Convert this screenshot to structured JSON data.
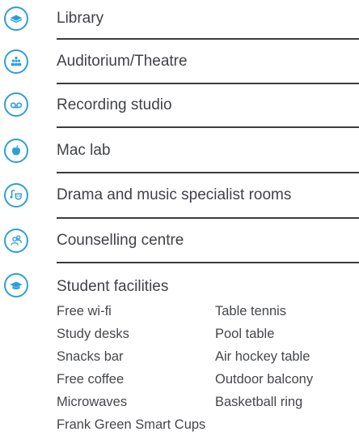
{
  "colors": {
    "accent": "#2f9fd8",
    "rule": "#3b3d40",
    "text": "#404247"
  },
  "items": [
    {
      "label": "Library",
      "icon": "book-icon"
    },
    {
      "label": "Auditorium/Theatre",
      "icon": "audience-icon"
    },
    {
      "label": "Recording studio",
      "icon": "voicemail-icon"
    },
    {
      "label": "Mac lab",
      "icon": "apple-icon"
    },
    {
      "label": "Drama and music specialist rooms",
      "icon": "music-drama-icon"
    },
    {
      "label": "Counselling centre",
      "icon": "people-icon"
    },
    {
      "label": "Student facilities",
      "icon": "graduation-cap-icon"
    }
  ],
  "facilities": {
    "left": [
      "Free wi-fi",
      "Study desks",
      "Snacks bar",
      "Free coffee",
      "Microwaves"
    ],
    "right": [
      "Table tennis",
      "Pool table",
      "Air hockey table",
      "Outdoor balcony",
      "Basketball ring"
    ],
    "full": "Frank Green Smart Cups"
  }
}
